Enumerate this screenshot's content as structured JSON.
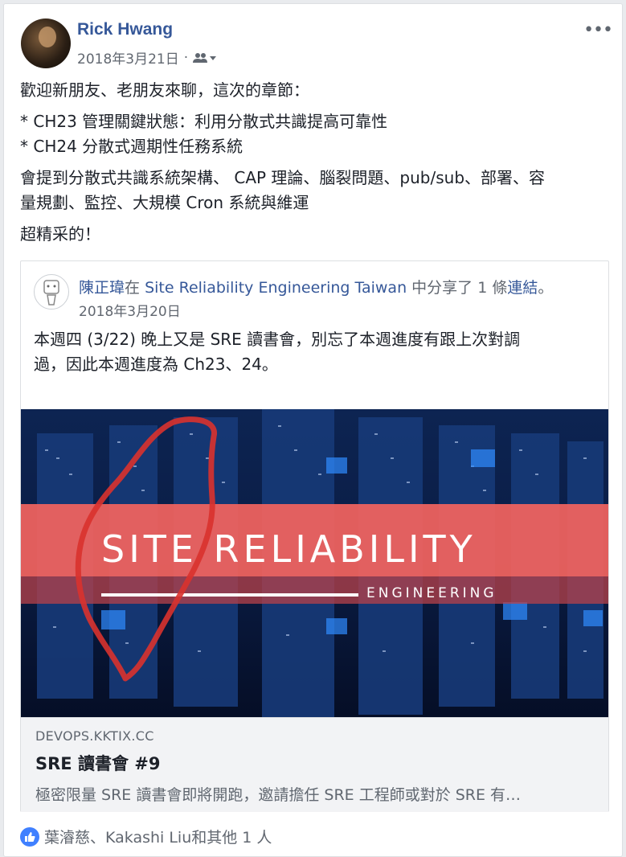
{
  "post": {
    "author": "Rick Hwang",
    "date": "2018年3月21日",
    "separator": "·",
    "audience_icon": "friends-icon",
    "more_label": "•••",
    "text_lines": [
      "歡迎新朋友、老朋友來聊，這次的章節：",
      "* CH23 管理關鍵狀態：利用分散式共識提高可靠性",
      "* CH24 分散式週期性任務系統",
      "會提到分散式共識系統架構、 CAP 理論、腦裂問題、pub/sub、部署、容",
      "量規劃、監控、大規模 Cron 系統與維運",
      "超精采的！"
    ]
  },
  "shared": {
    "author": "陳正瑋",
    "in": "在",
    "group": "Site Reliability Engineering Taiwan",
    "action": " 中分享了 1 條",
    "link_word": "連結",
    "period": "。",
    "date": "2018年3月20日",
    "text_lines": [
      "本週四 (3/22) 晚上又是 SRE 讀書會，別忘了本週進度有跟上次對調",
      "過，因此本週進度為 Ch23、24。"
    ]
  },
  "link": {
    "image_title": "SITE RELIABILITY",
    "image_subtitle": "ENGINEERING",
    "domain": "DEVOPS.KKTIX.CC",
    "title": "SRE 讀書會 #9",
    "description": "極密限量 SRE 讀書會即將開跑，邀請擔任 SRE 工程師或對於 SRE 有…"
  },
  "reactions": {
    "icon": "like-icon",
    "text": "葉濬慈、Kakashi Liu和其他 1 人"
  },
  "colors": {
    "link_blue": "#365899",
    "banner_red": "#f2635f",
    "like_blue": "#4080ff"
  }
}
